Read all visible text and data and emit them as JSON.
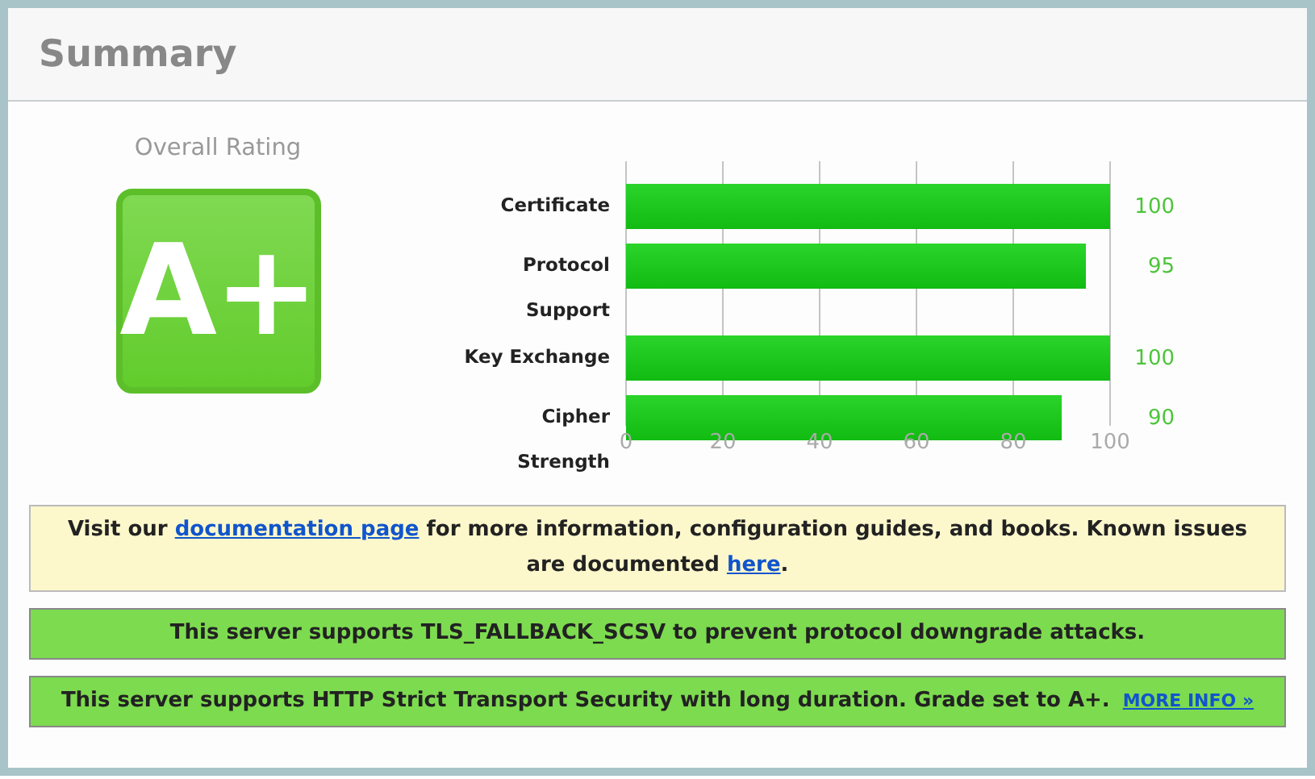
{
  "header": {
    "title": "Summary"
  },
  "rating": {
    "label": "Overall Rating",
    "grade": "A+"
  },
  "chart": {
    "chart_data": {
      "type": "bar",
      "orientation": "horizontal",
      "categories": [
        "Certificate",
        "Protocol Support",
        "Key Exchange",
        "Cipher Strength"
      ],
      "series": [
        {
          "color": "#11bb11",
          "values": [
            100,
            95,
            100,
            90
          ]
        }
      ],
      "xlim": [
        0,
        100
      ],
      "xticks": [
        0,
        20,
        40,
        60,
        80,
        100
      ],
      "grid": true,
      "data_labels": true
    }
  },
  "notices": [
    {
      "kind": "info",
      "parts": [
        {
          "text": "Visit our "
        },
        {
          "link": "documentation page"
        },
        {
          "text": " for more information, configuration guides, and books. Known issues are documented "
        },
        {
          "link": "here"
        },
        {
          "text": "."
        }
      ]
    },
    {
      "kind": "success",
      "parts": [
        {
          "text": "This server supports TLS_FALLBACK_SCSV to prevent protocol downgrade attacks."
        }
      ]
    },
    {
      "kind": "success",
      "parts": [
        {
          "text": "This server supports HTTP Strict Transport Security with long duration. Grade set to A+."
        },
        {
          "more": "MORE INFO »"
        }
      ]
    }
  ]
}
